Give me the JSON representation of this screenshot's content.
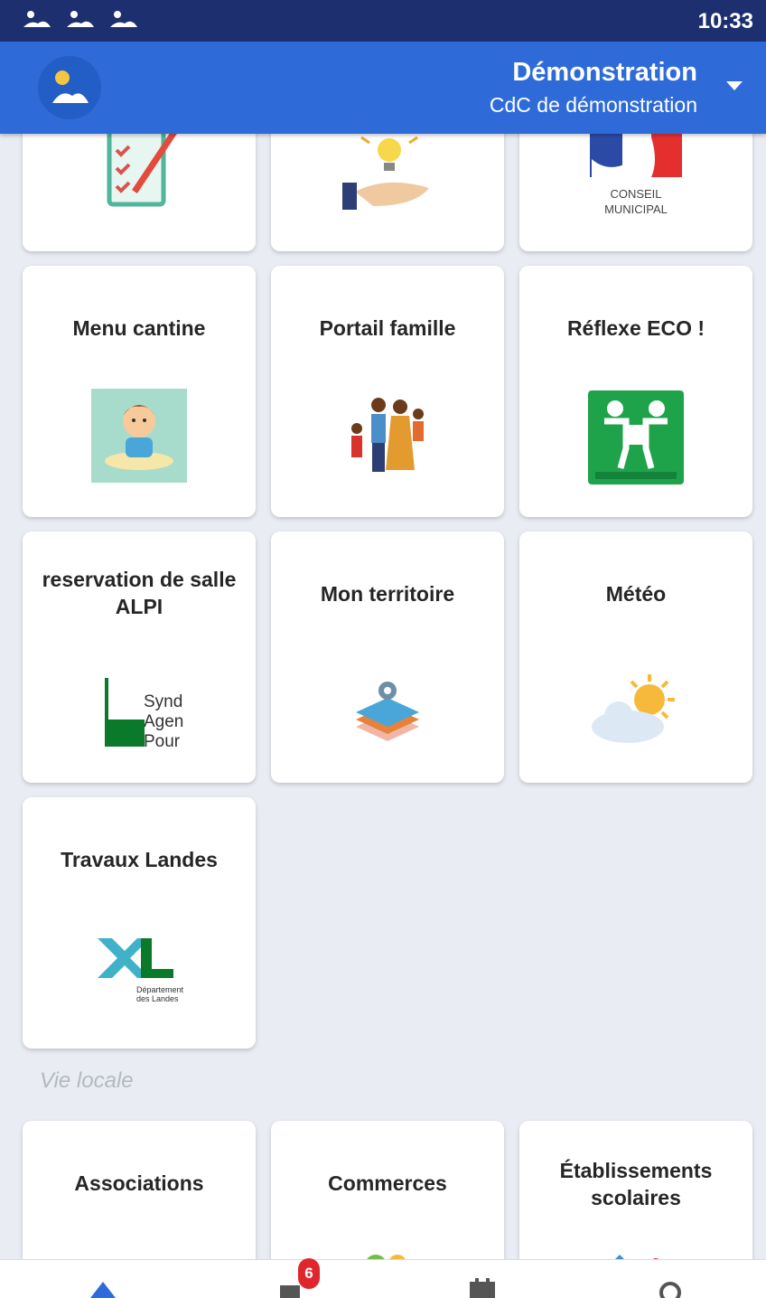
{
  "status_bar": {
    "time": "10:33",
    "notification_icons": [
      "app-notification-icon",
      "app-notification-icon",
      "app-notification-icon"
    ]
  },
  "app_bar": {
    "title": "Démonstration",
    "subtitle": "CdC de démonstration",
    "dropdown_icon": "chevron-down-icon"
  },
  "top_cards_partial": [
    {
      "icon": "checklist-icon"
    },
    {
      "icon": "idea-lightbulb-hand-icon"
    },
    {
      "icon": "conseil-municipal-icon",
      "caption_line1": "CONSEIL",
      "caption_line2": "MUNICIPAL"
    }
  ],
  "cards": [
    {
      "label": "Menu cantine",
      "icon": "child-eating-icon"
    },
    {
      "label": "Portail famille",
      "icon": "family-icon"
    },
    {
      "label": "Réflexe ECO !",
      "icon": "eco-reflex-icon"
    },
    {
      "label": "reservation de salle ALPI",
      "icon": "synd-agen-logo-icon",
      "logo_text": [
        "Synd",
        "Agen",
        "Pour"
      ]
    },
    {
      "label": "Mon territoire",
      "icon": "map-layers-icon"
    },
    {
      "label": "Météo",
      "icon": "weather-sun-cloud-icon"
    },
    {
      "label": "Travaux Landes",
      "icon": "landes-departement-logo-icon",
      "logo_text": [
        "Département",
        "des Landes"
      ]
    }
  ],
  "section_title": "Vie locale",
  "vie_locale_cards": [
    {
      "label": "Associations"
    },
    {
      "label": "Commerces"
    },
    {
      "label": "Établissements scolaires"
    }
  ],
  "bottom_nav": {
    "items": [
      {
        "icon": "home-icon"
      },
      {
        "icon": "news-icon",
        "badge": "6"
      },
      {
        "icon": "calendar-icon"
      },
      {
        "icon": "settings-icon"
      }
    ]
  },
  "colors": {
    "primary": "#2e6bd8",
    "status_bar": "#1d2f6e",
    "background": "#e9ecf3",
    "card": "#ffffff",
    "badge": "#e0262d"
  }
}
